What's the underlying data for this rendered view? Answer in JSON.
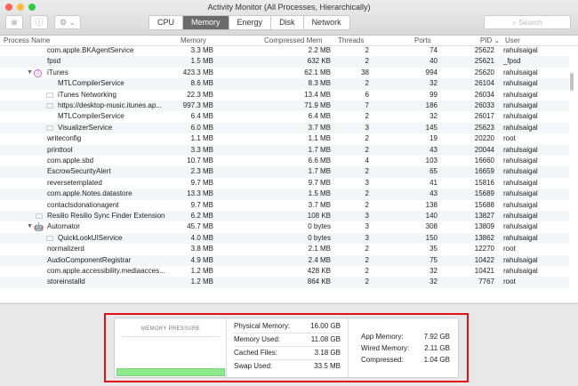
{
  "window": {
    "title": "Activity Monitor (All Processes, Hierarchically)"
  },
  "toolbar": {
    "tabs": [
      "CPU",
      "Memory",
      "Energy",
      "Disk",
      "Network"
    ],
    "active_tab": "Memory",
    "search_placeholder": "Search",
    "close_glyph": "⊗",
    "info_glyph": "ⓘ",
    "gear_glyph": "⚙ ⌄"
  },
  "columns": {
    "name": "Process Name",
    "memory": "Memory",
    "compressed": "Compressed Mem",
    "threads": "Threads",
    "ports": "Ports",
    "pid": "PID ⌄",
    "user": "User"
  },
  "rows": [
    {
      "name": "com.apple.BKAgentService",
      "memory": "3.3 MB",
      "compressed": "2.2 MB",
      "threads": "2",
      "ports": "74",
      "pid": "25622",
      "user": "rahulsaigal",
      "level": 0,
      "icon": "none"
    },
    {
      "name": "fpsd",
      "memory": "1.5 MB",
      "compressed": "632 KB",
      "threads": "2",
      "ports": "40",
      "pid": "25621",
      "user": "_fpsd",
      "level": 0,
      "icon": "none"
    },
    {
      "name": "iTunes",
      "memory": "423.3 MB",
      "compressed": "62.1 MB",
      "threads": "38",
      "ports": "994",
      "pid": "25620",
      "user": "rahulsaigal",
      "level": 0,
      "icon": "itunes",
      "expanded": true
    },
    {
      "name": "MTLCompilerService",
      "memory": "8.6 MB",
      "compressed": "8.3 MB",
      "threads": "2",
      "ports": "32",
      "pid": "26104",
      "user": "rahulsaigal",
      "level": 1,
      "icon": "none"
    },
    {
      "name": "iTunes Networking",
      "memory": "22.3 MB",
      "compressed": "13.4 MB",
      "threads": "6",
      "ports": "99",
      "pid": "26034",
      "user": "rahulsaigal",
      "level": 1,
      "icon": "generic"
    },
    {
      "name": "https://desktop-music.itunes.ap...",
      "memory": "997.3 MB",
      "compressed": "71.9 MB",
      "threads": "7",
      "ports": "186",
      "pid": "26033",
      "user": "rahulsaigal",
      "level": 1,
      "icon": "generic"
    },
    {
      "name": "MTLCompilerService",
      "memory": "6.4 MB",
      "compressed": "6.4 MB",
      "threads": "2",
      "ports": "32",
      "pid": "26017",
      "user": "rahulsaigal",
      "level": 1,
      "icon": "none"
    },
    {
      "name": "VisualizerService",
      "memory": "6.0 MB",
      "compressed": "3.7 MB",
      "threads": "3",
      "ports": "145",
      "pid": "25623",
      "user": "rahulsaigal",
      "level": 1,
      "icon": "generic"
    },
    {
      "name": "writeconfig",
      "memory": "1.1 MB",
      "compressed": "1.1 MB",
      "threads": "2",
      "ports": "19",
      "pid": "20220",
      "user": "root",
      "level": 0,
      "icon": "none"
    },
    {
      "name": "printtool",
      "memory": "3.3 MB",
      "compressed": "1.7 MB",
      "threads": "2",
      "ports": "43",
      "pid": "20044",
      "user": "rahulsaigal",
      "level": 0,
      "icon": "none"
    },
    {
      "name": "com.apple.sbd",
      "memory": "10.7 MB",
      "compressed": "6.6 MB",
      "threads": "4",
      "ports": "103",
      "pid": "16660",
      "user": "rahulsaigal",
      "level": 0,
      "icon": "none"
    },
    {
      "name": "EscrowSecurityAlert",
      "memory": "2.3 MB",
      "compressed": "1.7 MB",
      "threads": "2",
      "ports": "65",
      "pid": "16659",
      "user": "rahulsaigal",
      "level": 0,
      "icon": "none"
    },
    {
      "name": "reversetemplated",
      "memory": "9.7 MB",
      "compressed": "9.7 MB",
      "threads": "3",
      "ports": "41",
      "pid": "15816",
      "user": "rahulsaigal",
      "level": 0,
      "icon": "none"
    },
    {
      "name": "com.apple.Notes.datastore",
      "memory": "13.3 MB",
      "compressed": "1.5 MB",
      "threads": "2",
      "ports": "43",
      "pid": "15689",
      "user": "rahulsaigal",
      "level": 0,
      "icon": "none"
    },
    {
      "name": "contactsdonationagent",
      "memory": "9.7 MB",
      "compressed": "3.7 MB",
      "threads": "2",
      "ports": "138",
      "pid": "15688",
      "user": "rahulsaigal",
      "level": 0,
      "icon": "none"
    },
    {
      "name": "Resilio Resilio Sync Finder Extension",
      "memory": "6.2 MB",
      "compressed": "108 KB",
      "threads": "3",
      "ports": "140",
      "pid": "13827",
      "user": "rahulsaigal",
      "level": 0,
      "icon": "generic"
    },
    {
      "name": "Automator",
      "memory": "45.7 MB",
      "compressed": "0 bytes",
      "threads": "3",
      "ports": "308",
      "pid": "13809",
      "user": "rahulsaigal",
      "level": 0,
      "icon": "automator",
      "expanded": true
    },
    {
      "name": "QuickLookUIService",
      "memory": "4.0 MB",
      "compressed": "0 bytes",
      "threads": "3",
      "ports": "150",
      "pid": "13862",
      "user": "rahulsaigal",
      "level": 1,
      "icon": "generic"
    },
    {
      "name": "normalizerd",
      "memory": "3.8 MB",
      "compressed": "2.1 MB",
      "threads": "2",
      "ports": "35",
      "pid": "12270",
      "user": "root",
      "level": 0,
      "icon": "none"
    },
    {
      "name": "AudioComponentRegistrar",
      "memory": "4.9 MB",
      "compressed": "2.4 MB",
      "threads": "2",
      "ports": "75",
      "pid": "10422",
      "user": "rahulsaigal",
      "level": 0,
      "icon": "none"
    },
    {
      "name": "com.apple.accessibility.mediaacces...",
      "memory": "1.2 MB",
      "compressed": "428 KB",
      "threads": "2",
      "ports": "32",
      "pid": "10421",
      "user": "rahulsaigal",
      "level": 0,
      "icon": "none"
    },
    {
      "name": "storeinstalld",
      "memory": "1.2 MB",
      "compressed": "864 KB",
      "threads": "2",
      "ports": "32",
      "pid": "7767",
      "user": "root",
      "level": 0,
      "icon": "none"
    }
  ],
  "memory_panel": {
    "pressure_label": "MEMORY PRESSURE",
    "pressure_color": "#8ee98a",
    "stats": [
      {
        "label": "Physical Memory:",
        "value": "16.00 GB"
      },
      {
        "label": "Memory Used:",
        "value": "11.08 GB"
      },
      {
        "label": "Cached Files:",
        "value": "3.18 GB"
      },
      {
        "label": "Swap Used:",
        "value": "33.5 MB"
      }
    ],
    "breakdown": [
      {
        "label": "App Memory:",
        "value": "7.92 GB"
      },
      {
        "label": "Wired Memory:",
        "value": "2.11 GB"
      },
      {
        "label": "Compressed:",
        "value": "1.04 GB"
      }
    ]
  }
}
